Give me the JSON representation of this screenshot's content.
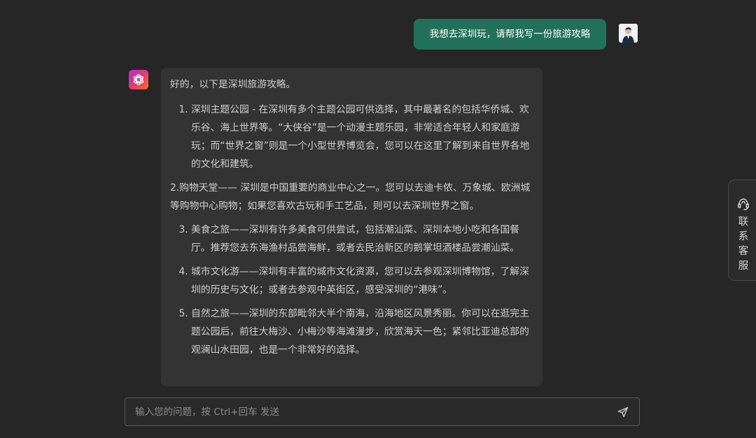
{
  "user_message": {
    "text": "我想去深圳玩，请帮我写一份旅游攻略"
  },
  "bot_message": {
    "intro": "好的，以下是深圳旅游攻略。",
    "item1": "深圳主题公园 - 在深圳有多个主题公园可供选择，其中最著名的包括华侨城、欢乐谷、海上世界等。“大侠谷”是一个动漫主题乐园，非常适合年轻人和家庭游玩；而“世界之窗”则是一个小型世界博览会，您可以在这里了解到来自世界各地的文化和建筑。",
    "item2": "2.购物天堂—— 深圳是中国重要的商业中心之一。您可以去迪卡侬、万象城、欧洲城等购物中心购物；如果您喜欢古玩和手工艺品，则可以去深圳世界之窗。",
    "items_rest": [
      "美食之旅——深圳有许多美食可供尝试，包括潮汕菜、深圳本地小吃和各国餐厅。推荐您去东海渔村品尝海鲜，或者去民治新区的鹅掌坦酒楼品尝潮汕菜。",
      "城市文化游——深圳有丰富的城市文化资源，您可以去参观深圳博物馆，了解深圳的历史与文化；或者去参观中英街区，感受深圳的“港味”。",
      "自然之旅——深圳的东部毗邻大半个南海，沿海地区风景秀丽。你可以在逛完主题公园后，前往大梅沙、小梅沙等海滩漫步，欣赏海天一色；紧邻比亚迪总部的观澜山水田园，也是一个非常好的选择。"
    ]
  },
  "contact_tab": {
    "label": "联系客服",
    "icon": "headset-icon"
  },
  "input": {
    "placeholder": "输入您的问题，按 Ctrl+回车 发送",
    "value": ""
  },
  "colors": {
    "background": "#262627",
    "user_bubble": "#22705a",
    "bot_bubble": "#333334"
  }
}
